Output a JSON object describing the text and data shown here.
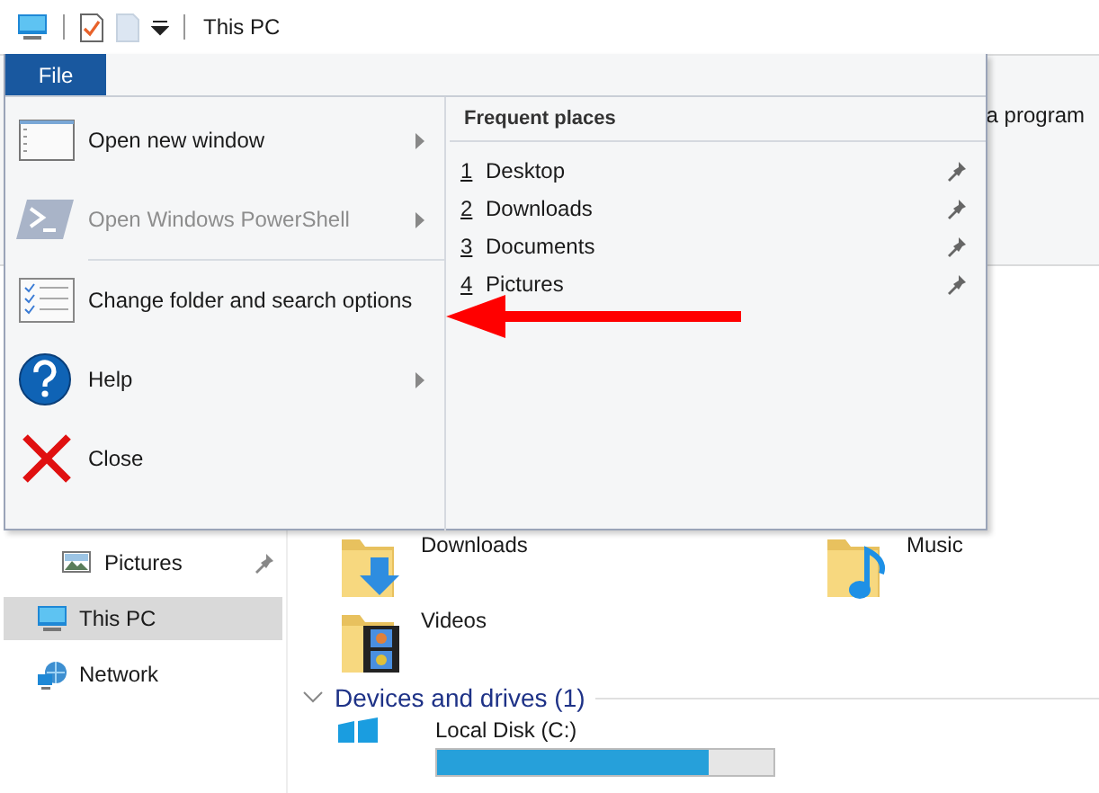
{
  "title_bar": {
    "title": "This PC"
  },
  "ribbon": {
    "visible_text": "a program"
  },
  "file_menu": {
    "tab": {
      "label": "File",
      "selected": true
    },
    "commands": [
      {
        "kind": "window",
        "label": "Open new window",
        "submenu": true,
        "disabled": false
      },
      {
        "kind": "powershell",
        "label": "Open Windows PowerShell",
        "submenu": true,
        "disabled": true
      },
      {
        "kind": "options",
        "label": "Change folder and search options",
        "submenu": false,
        "disabled": false
      },
      {
        "kind": "help",
        "label": "Help",
        "submenu": true,
        "disabled": false
      },
      {
        "kind": "close",
        "label": "Close",
        "submenu": false,
        "disabled": false
      }
    ],
    "frequent_places": {
      "title": "Frequent places",
      "items": [
        {
          "number": "1",
          "name": "Desktop",
          "pinned": true
        },
        {
          "number": "2",
          "name": "Downloads",
          "pinned": true
        },
        {
          "number": "3",
          "name": "Documents",
          "pinned": true
        },
        {
          "number": "4",
          "name": "Pictures",
          "pinned": true
        }
      ]
    }
  },
  "annotation": {
    "kind": "arrow"
  },
  "navigation": {
    "items": [
      {
        "kind": "pictures",
        "label": "Pictures",
        "pinned": true,
        "selected": false
      },
      {
        "kind": "pc",
        "label": "This PC",
        "pinned": false,
        "selected": true
      },
      {
        "kind": "network",
        "label": "Network",
        "pinned": false,
        "selected": false
      }
    ]
  },
  "folders": [
    {
      "kind": "downloads",
      "name": "Downloads"
    },
    {
      "kind": "music",
      "name": "Music"
    },
    {
      "kind": "videos",
      "name": "Videos"
    }
  ],
  "devices": {
    "heading": "Devices and drives (1)",
    "expanded": true,
    "drives": [
      {
        "name": "Local Disk (C:)",
        "level": 0.81
      }
    ]
  }
}
